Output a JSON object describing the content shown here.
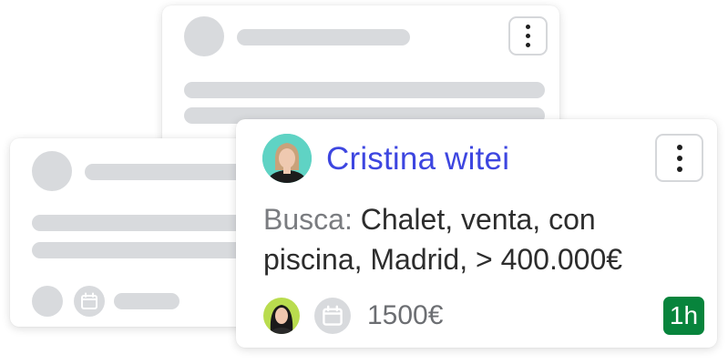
{
  "lead_card": {
    "name": "Cristina witei",
    "search_label": "Busca:",
    "search_text": " Chalet, venta, con piscina, Madrid, > 400.000€",
    "price": "1500€",
    "time_badge": "1h",
    "icons": [
      "more-vertical-icon",
      "calendar-icon"
    ]
  },
  "colors": {
    "name": "#3d46e0",
    "badge": "#07843c",
    "placeholder": "#d8dadd"
  }
}
